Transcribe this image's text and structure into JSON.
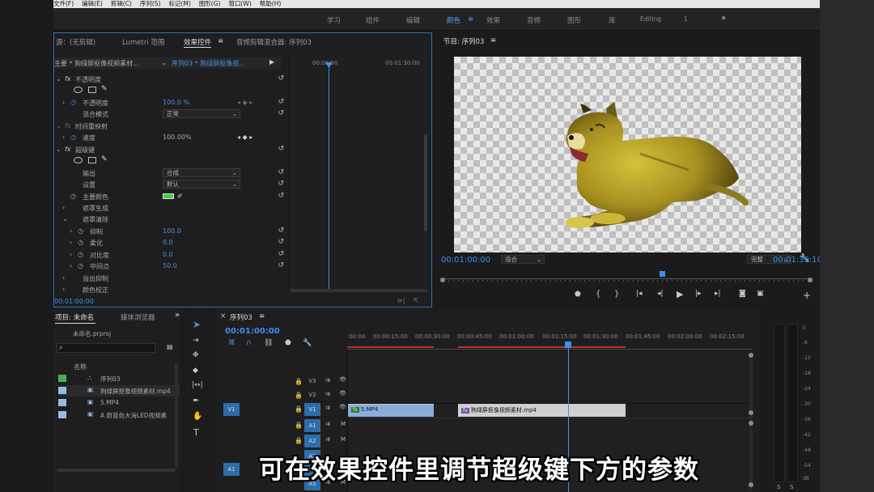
{
  "menu": [
    "文件(F)",
    "编辑(E)",
    "剪辑(C)",
    "序列(S)",
    "标记(M)",
    "图形(G)",
    "窗口(W)",
    "帮助(H)"
  ],
  "workspaces": [
    {
      "label": "学习",
      "active": false
    },
    {
      "label": "组件",
      "active": false
    },
    {
      "label": "编辑",
      "active": false
    },
    {
      "label": "颜色",
      "active": true
    },
    {
      "label": "效果",
      "active": false
    },
    {
      "label": "音频",
      "active": false
    },
    {
      "label": "图形",
      "active": false
    },
    {
      "label": "库",
      "active": false
    },
    {
      "label": "Editing",
      "active": false
    },
    {
      "label": "1",
      "active": false
    }
  ],
  "workspace_more": "»",
  "source_tabs": [
    "源：(无剪辑)",
    "Lumetri 范围",
    "效果控件",
    "音频剪辑混合器: 序列03"
  ],
  "source_menu": "≡",
  "effects": {
    "master_label": "主要 * 狗绿屏抠像视频素材...",
    "seq_label": "序列03 * 狗绿屏抠像视...",
    "ruler_start": "00:00:00",
    "ruler_end": "00:01:30:00",
    "fx": "fx",
    "opacity_group": "不透明度",
    "opacity_label": "不透明度",
    "opacity_value": "100.0 %",
    "blend_label": "混合模式",
    "blend_value": "正常",
    "timeremap_group": "时间重映射",
    "speed_label": "速度",
    "speed_value": "100.00%",
    "ultrakey_group": "超级键",
    "output_label": "输出",
    "output_value": "合成",
    "setting_label": "设置",
    "setting_value": "默认",
    "keycolor_label": "主要颜色",
    "key_color": "#3dd43d",
    "matte_gen": "遮罩生成",
    "matte_clean": "遮罩清除",
    "choke_label": "抑制",
    "choke_value": "100.0",
    "soften_label": "柔化",
    "soften_value": "0.0",
    "contrast_label": "对比度",
    "contrast_value": "0.0",
    "midpoint_label": "中间点",
    "midpoint_value": "50.0",
    "spill_label": "溢出抑制",
    "colorcorr_label": "颜色校正",
    "timecode": "00:01:00:00"
  },
  "program": {
    "title": "节目: 序列03",
    "menu": "≡",
    "timecode": "00:01:00:00",
    "fit": "适合",
    "quality": "完整",
    "duration": "00:01:39:10"
  },
  "project": {
    "tabs": [
      "项目: 未命名",
      "媒体浏览器"
    ],
    "more": "»",
    "file": "未命名.prproj",
    "col_name": "名称",
    "items": [
      {
        "name": "序列03",
        "color": "#4caf50"
      },
      {
        "name": "狗绿屏抠像视频素材.mp4",
        "color": "#9ab8e8"
      },
      {
        "name": "5.MP4",
        "color": "#9ab8e8"
      },
      {
        "name": "A 蔚蓝色大海LED视频素",
        "color": "#9ab8e8"
      }
    ]
  },
  "timeline": {
    "title": "序列03",
    "menu": "≡",
    "timecode": "00:01:00:00",
    "ruler": [
      ":00:00",
      "00:00:15:00",
      "00:00:30:00",
      "00:00:45:00",
      "00:01:00:00",
      "00:01:15:00",
      "00:01:30:00",
      "00:01:45:00",
      "00:02:00:00",
      "00:02:15:00"
    ],
    "tracks": [
      {
        "src": "",
        "name": "V3"
      },
      {
        "src": "",
        "name": "V2"
      },
      {
        "src": "V1",
        "name": "V1"
      },
      {
        "src": "",
        "name": "A1"
      },
      {
        "src": "",
        "name": "A2"
      },
      {
        "src": "",
        "name": "A3"
      },
      {
        "src": "A1",
        "name": "A4"
      },
      {
        "src": "",
        "name": "A5"
      }
    ],
    "clip1": "5.MP4",
    "clip2": "狗绿屏抠像视频素材.mp4",
    "fx": "fx"
  },
  "meter": {
    "scale": [
      "0",
      "-6",
      "-12",
      "-18",
      "-24",
      "-30",
      "-36",
      "-42",
      "-48",
      "-54",
      "dB"
    ],
    "solo": [
      "S",
      "S"
    ]
  },
  "subtitle": "可在效果控件里调节超级键下方的参数"
}
